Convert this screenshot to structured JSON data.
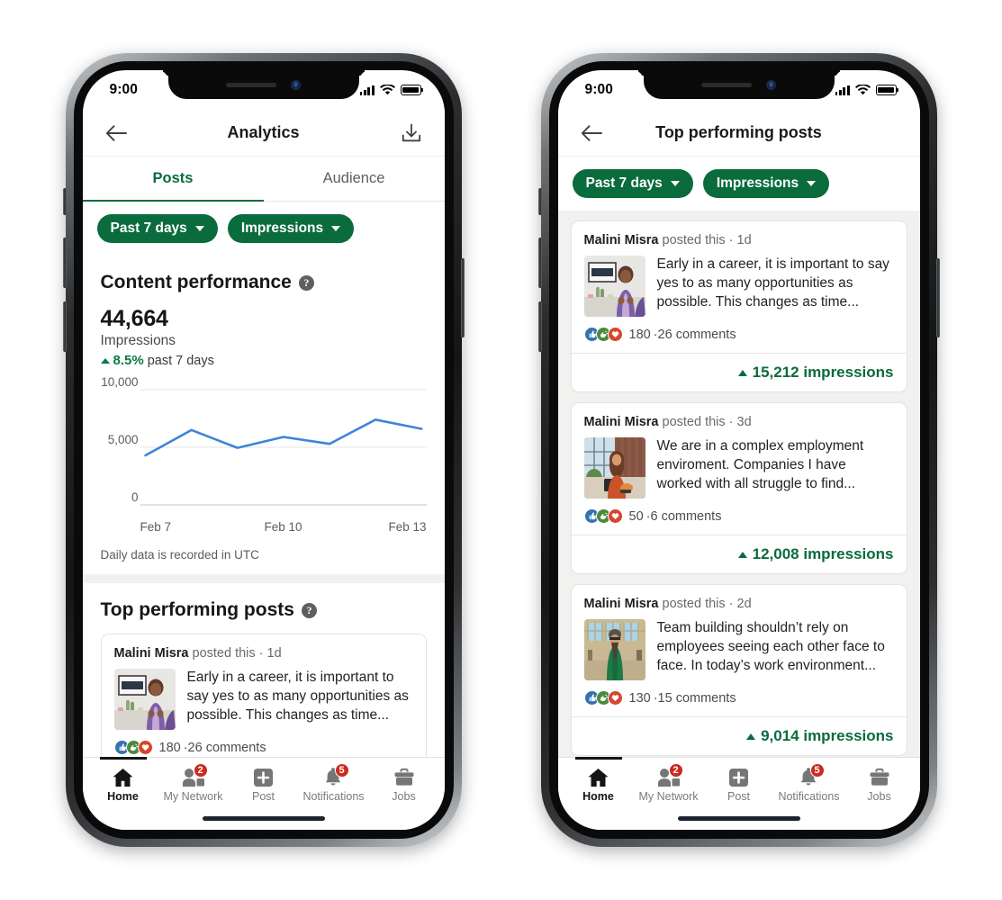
{
  "accent_green": "#0a6b3d",
  "chart_line_color": "#3d85d8",
  "badge_red": "#cc2a1f",
  "status_bar": {
    "time": "9:00",
    "signal_icon": "cellular-bars-icon",
    "wifi_icon": "wifi-icon",
    "battery_icon": "battery-full-icon"
  },
  "phone_left": {
    "navbar": {
      "back_icon": "back-arrow-icon",
      "title": "Analytics",
      "download_icon": "download-icon"
    },
    "tabs": [
      {
        "label": "Posts",
        "active": true
      },
      {
        "label": "Audience",
        "active": false
      }
    ],
    "filters": [
      {
        "label": "Past 7 days",
        "icon": "chevron-down-icon"
      },
      {
        "label": "Impressions",
        "icon": "chevron-down-icon"
      }
    ],
    "content_performance": {
      "title": "Content performance",
      "help_icon": "help-question-icon",
      "value": "44,664",
      "metric_label": "Impressions",
      "delta_arrow_icon": "triangle-up-icon",
      "delta_value": "8.5%",
      "delta_period": "past 7 days",
      "footnote": "Daily data is recorded in UTC"
    },
    "top_posts": {
      "title": "Top performing posts",
      "help_icon": "help-question-icon"
    }
  },
  "phone_right": {
    "navbar": {
      "back_icon": "back-arrow-icon",
      "title": "Top performing posts"
    },
    "filters": [
      {
        "label": "Past 7 days",
        "icon": "chevron-down-icon"
      },
      {
        "label": "Impressions",
        "icon": "chevron-down-icon"
      }
    ]
  },
  "posts": [
    {
      "author": "Malini Misra",
      "action": " posted this · ",
      "time": "1d",
      "text": "Early in a career, it is important to say yes to as many opportunities as possible. This changes as time...",
      "reactions": [
        "like-icon",
        "celebrate-icon",
        "love-icon"
      ],
      "reaction_count": "180",
      "comments": "26 comments",
      "separator": " · ",
      "impressions": "15,212 impressions",
      "impressions_arrow_icon": "triangle-up-icon",
      "thumb": "woman-purple-cardigan-indoor-thumbnail"
    },
    {
      "author": "Malini Misra",
      "action": " posted this · ",
      "time": "3d",
      "text": "We are in a complex employment enviroment. Companies I have worked with all struggle to find...",
      "reactions": [
        "like-icon",
        "celebrate-icon",
        "love-icon"
      ],
      "reaction_count": "50",
      "comments": "6 comments",
      "separator": " · ",
      "impressions": "12,008 impressions",
      "impressions_arrow_icon": "triangle-up-icon",
      "thumb": "woman-orange-sweater-desk-thumbnail"
    },
    {
      "author": "Malini Misra",
      "action": " posted this · ",
      "time": "2d",
      "text": "Team building shouldn’t rely on employees seeing each other face to face. In today’s work environment...",
      "reactions": [
        "like-icon",
        "celebrate-icon",
        "love-icon"
      ],
      "reaction_count": "130",
      "comments": "15 comments",
      "separator": " · ",
      "impressions": "9,014 impressions",
      "impressions_arrow_icon": "triangle-up-icon",
      "thumb": "woman-green-coat-station-thumbnail"
    }
  ],
  "bottom_nav": [
    {
      "label": "Home",
      "icon": "home-icon",
      "active": true,
      "badge": null
    },
    {
      "label": "My Network",
      "icon": "my-network-icon",
      "active": false,
      "badge": "2"
    },
    {
      "label": "Post",
      "icon": "plus-square-icon",
      "active": false,
      "badge": null
    },
    {
      "label": "Notifications",
      "icon": "bell-icon",
      "active": false,
      "badge": "5"
    },
    {
      "label": "Jobs",
      "icon": "briefcase-icon",
      "active": false,
      "badge": null
    }
  ],
  "chart_data": {
    "type": "line",
    "title": "Content performance",
    "xlabel": "",
    "ylabel": "Impressions",
    "x": [
      "Feb 7",
      "Feb 8",
      "Feb 9",
      "Feb 10",
      "Feb 11",
      "Feb 12",
      "Feb 13"
    ],
    "tick_labels_shown": [
      "Feb 7",
      "Feb 10",
      "Feb 13"
    ],
    "values": [
      4300,
      6500,
      4950,
      5900,
      5300,
      7400,
      6600
    ],
    "ylim": [
      0,
      10000
    ],
    "yticks": [
      0,
      5000,
      10000
    ],
    "ytick_labels": [
      "0",
      "5,000",
      "10,000"
    ],
    "grid": true,
    "legend": "none",
    "line_color": "#3d85d8",
    "note": "Daily data is recorded in UTC"
  }
}
